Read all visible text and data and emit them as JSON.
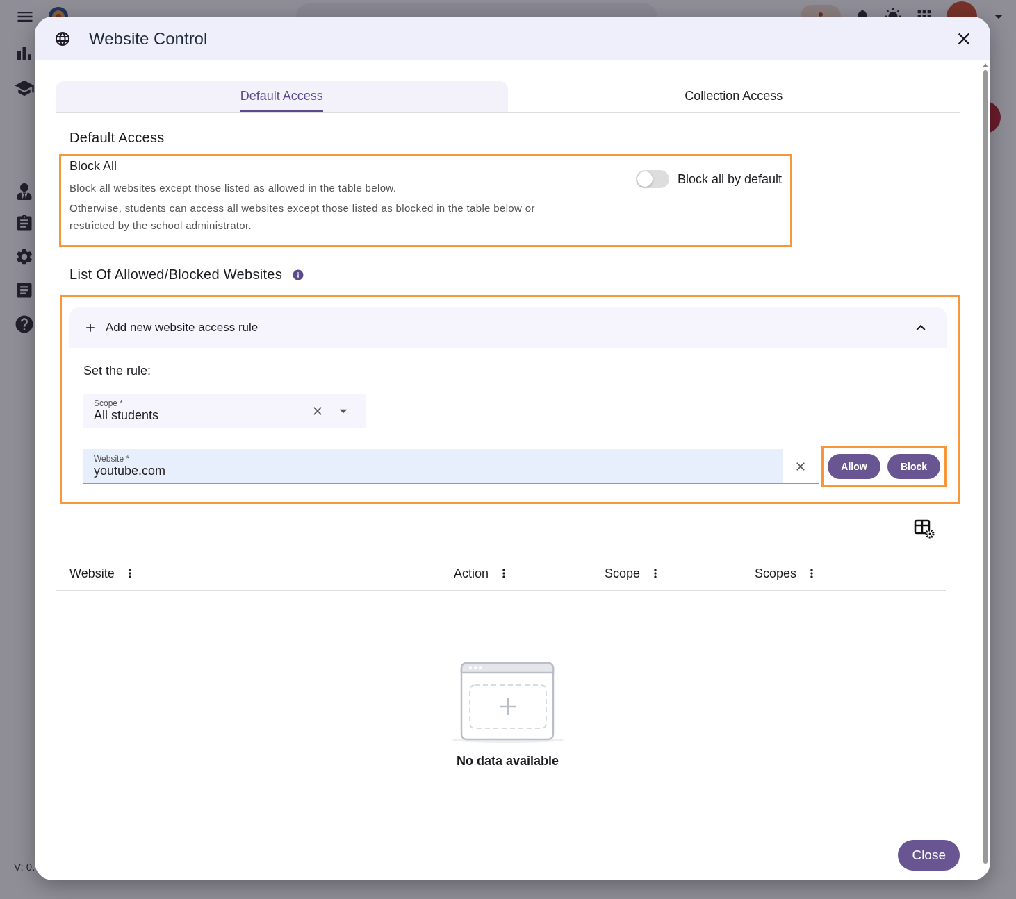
{
  "app": {
    "version": "V: 0."
  },
  "dialog": {
    "title": "Website Control",
    "tabs": [
      {
        "label": "Default Access",
        "selected": true
      },
      {
        "label": "Collection Access",
        "selected": false
      }
    ],
    "section_title": "Default Access",
    "block_all": {
      "title": "Block All",
      "lines": [
        "Block all websites except those listed as allowed in the table below.",
        "Otherwise, students can access all websites except those listed as blocked in the table below or restricted by the school administrator."
      ],
      "toggle_label": "Block all by default",
      "on": false
    },
    "list_title": "List Of Allowed/Blocked Websites",
    "add_rule": {
      "label": "Add new website access rule",
      "expanded": true,
      "prompt": "Set the rule:",
      "scope": {
        "label": "Scope *",
        "value": "All students"
      },
      "website": {
        "label": "Website *",
        "value": "youtube.com"
      },
      "buttons": [
        "Allow",
        "Block"
      ]
    },
    "table": {
      "columns": [
        "Website",
        "Action",
        "Scope",
        "Scopes"
      ],
      "empty_text": "No data available"
    },
    "close_button": "Close"
  }
}
